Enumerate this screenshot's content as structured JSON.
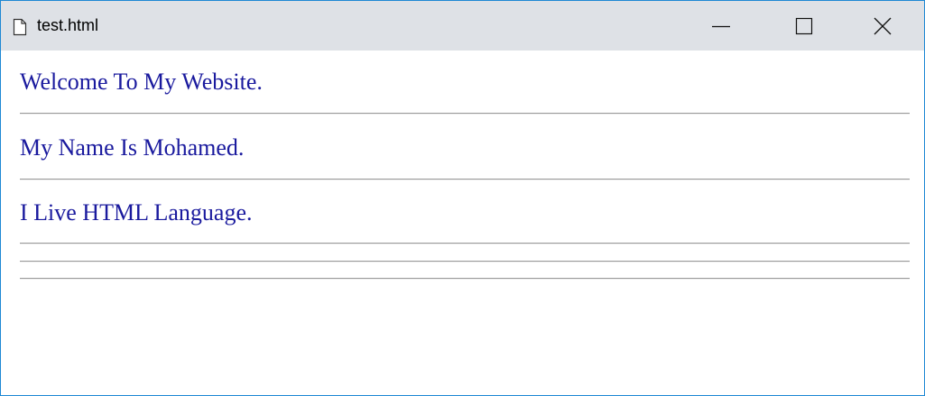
{
  "window": {
    "title": "test.html",
    "border_color": "#1e88d4",
    "titlebar_color": "#dee1e6",
    "icons": {
      "document": "document-icon",
      "minimize": "minimize-icon",
      "maximize": "maximize-icon",
      "close": "close-icon"
    }
  },
  "page": {
    "text_color": "#1a1a9e",
    "lines": [
      "Welcome To My Website.",
      "My Name Is Mohamed.",
      "I Live HTML Language."
    ]
  }
}
